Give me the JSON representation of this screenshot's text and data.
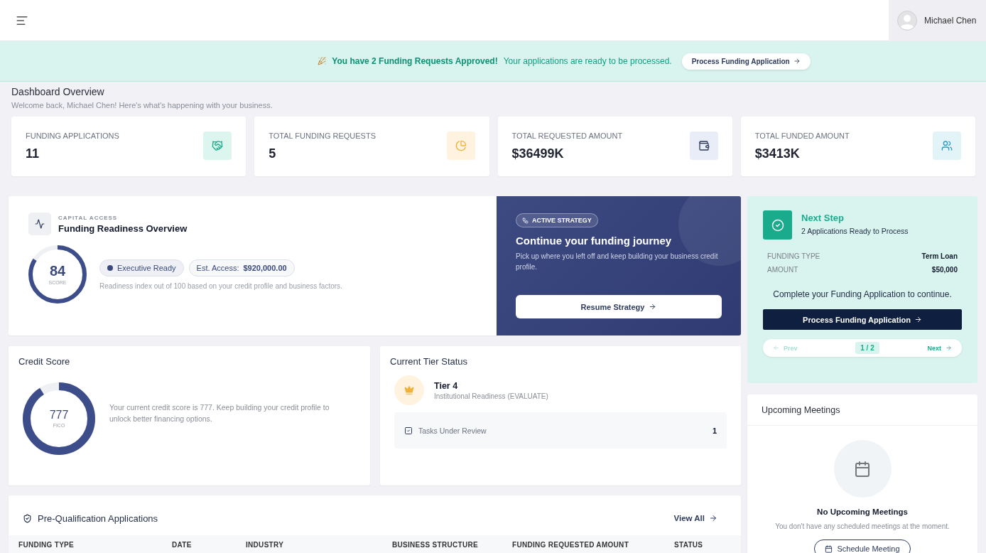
{
  "topbar": {
    "user_name": "Michael Chen"
  },
  "banner": {
    "headline": "You have 2 Funding Requests Approved!",
    "message": "Your applications are ready to be processed.",
    "button": "Process Funding Application"
  },
  "header": {
    "title": "Dashboard Overview",
    "subtitle": "Welcome back, Michael Chen! Here's what's happening with your business."
  },
  "stats": [
    {
      "label": "FUNDING APPLICATIONS",
      "value": "11",
      "kind": "handshake"
    },
    {
      "label": "TOTAL FUNDING REQUESTS",
      "value": "5",
      "kind": "pie"
    },
    {
      "label": "TOTAL REQUESTED AMOUNT",
      "value": "$36499K",
      "kind": "wallet"
    },
    {
      "label": "TOTAL FUNDED AMOUNT",
      "value": "$3413K",
      "kind": "users"
    }
  ],
  "readiness": {
    "eyebrow": "CAPITAL ACCESS",
    "title": "Funding Readiness Overview",
    "score": "84",
    "score_label": "SCORE",
    "level": 0.84,
    "status": "Executive Ready",
    "access_label": "Est. Access:",
    "access_value": "$920,000.00",
    "note": "Readiness index out of 100 based on your credit profile and business factors."
  },
  "strategy": {
    "badge": "ACTIVE STRATEGY",
    "title": "Continue your funding journey",
    "text": "Pick up where you left off and keep building your business credit profile.",
    "button": "Resume Strategy"
  },
  "next_step": {
    "title": "Next Step",
    "subtitle": "2 Applications Ready to Process",
    "details": [
      {
        "label": "FUNDING TYPE",
        "value": "Term Loan"
      },
      {
        "label": "AMOUNT",
        "value": "$50,000"
      }
    ],
    "message": "Complete your Funding Application to continue.",
    "button": "Process Funding Application",
    "pager": {
      "prev": {
        "label": "Prev",
        "disabled": true
      },
      "page": "1 / 2",
      "next": {
        "label": "Next",
        "disabled": false
      }
    }
  },
  "credit_score": {
    "title": "Credit Score",
    "score": "777",
    "score_label": "FICO",
    "level": 0.91,
    "text": "Your current credit score is 777. Keep building your credit profile to unlock better financing options."
  },
  "tier": {
    "title": "Current Tier Status",
    "tier": "Tier 4",
    "description": "Institutional Readiness (EVALUATE)",
    "tasks": [
      {
        "label": "Tasks Under Review",
        "count": "1"
      }
    ]
  },
  "prequal": {
    "title": "Pre-Qualification Applications",
    "link": "View All",
    "columns": [
      "FUNDING TYPE",
      "DATE",
      "INDUSTRY",
      "BUSINESS STRUCTURE",
      "FUNDING REQUESTED AMOUNT",
      "STATUS"
    ]
  },
  "meetings": {
    "title": "Upcoming Meetings",
    "empty_title": "No Upcoming Meetings",
    "empty_text": "You don't have any scheduled meetings at the moment.",
    "button": "Schedule Meeting"
  }
}
